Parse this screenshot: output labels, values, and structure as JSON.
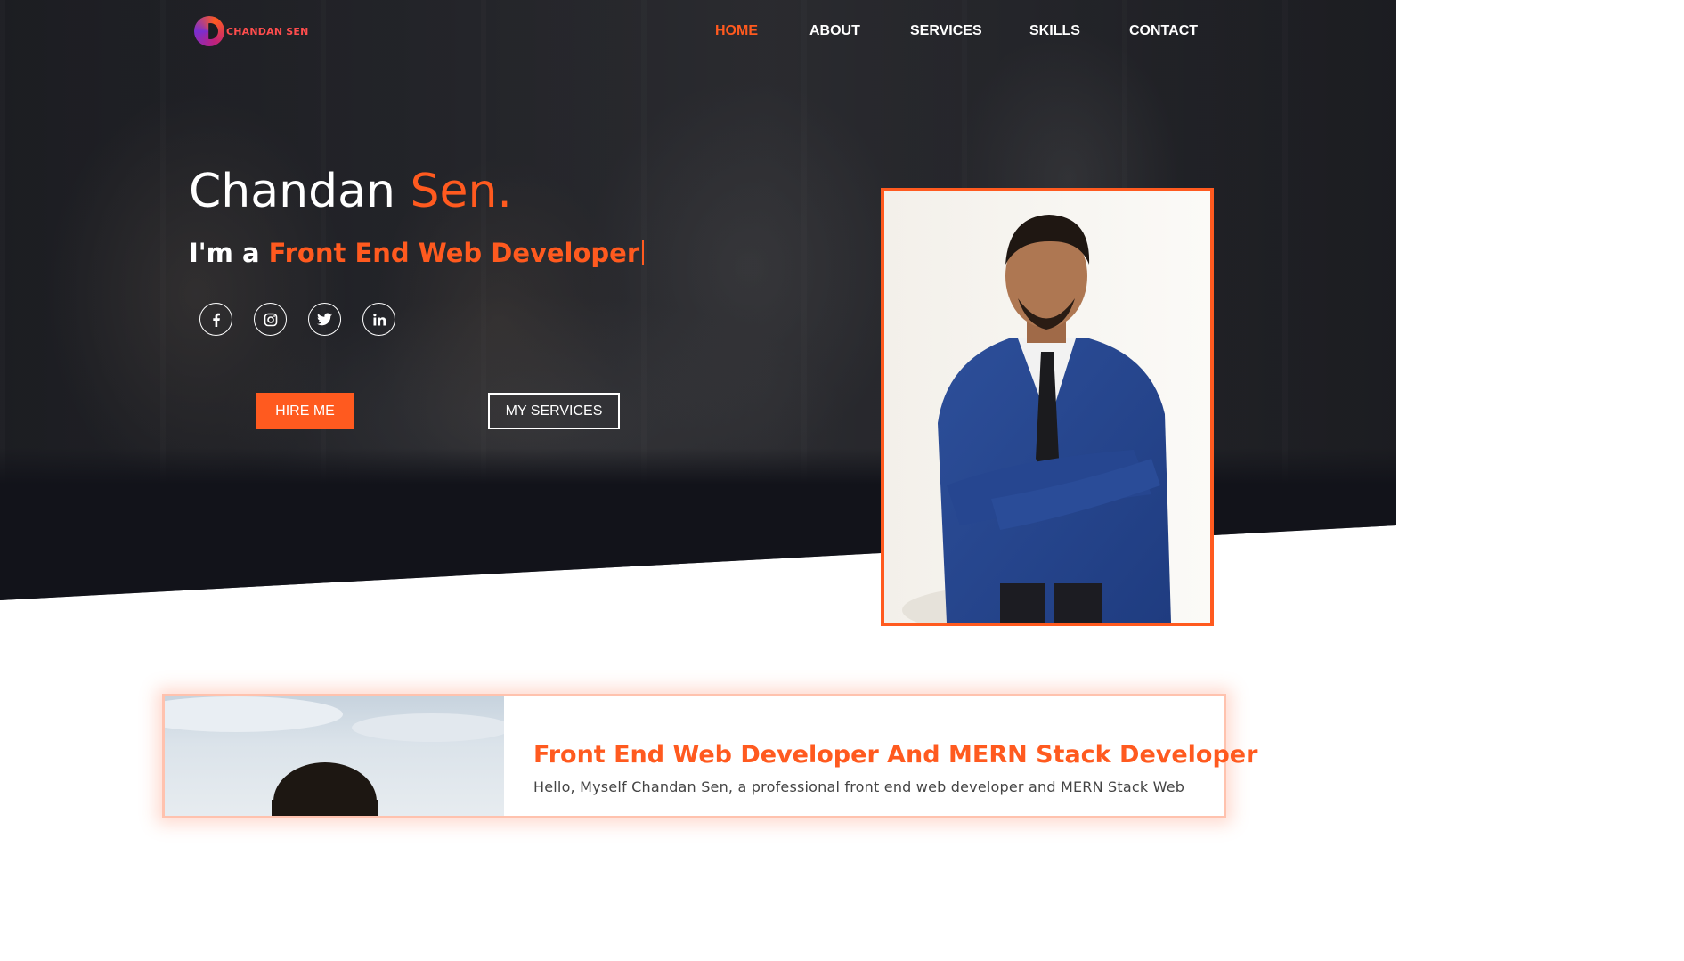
{
  "brand": {
    "logo_text": "CHANDAN SEN",
    "accent_color": "#ff5a1f"
  },
  "nav": {
    "items": [
      {
        "label": "HOME",
        "active": true
      },
      {
        "label": "ABOUT",
        "active": false
      },
      {
        "label": "SERVICES",
        "active": false
      },
      {
        "label": "SKILLS",
        "active": false
      },
      {
        "label": "CONTACT",
        "active": false
      }
    ]
  },
  "hero": {
    "first_name": "Chandan",
    "last_name": "Sen.",
    "role_prefix": "I'm a",
    "role": "Front End Web Developer",
    "social": [
      {
        "icon": "facebook-icon"
      },
      {
        "icon": "instagram-icon"
      },
      {
        "icon": "twitter-icon"
      },
      {
        "icon": "linkedin-icon"
      }
    ],
    "hire_label": "HIRE ME",
    "services_label": "MY SERVICES"
  },
  "about": {
    "heading": "Front End Web Developer And MERN Stack Developer",
    "text": "Hello, Myself Chandan Sen, a professional front end web developer and MERN Stack Web"
  }
}
